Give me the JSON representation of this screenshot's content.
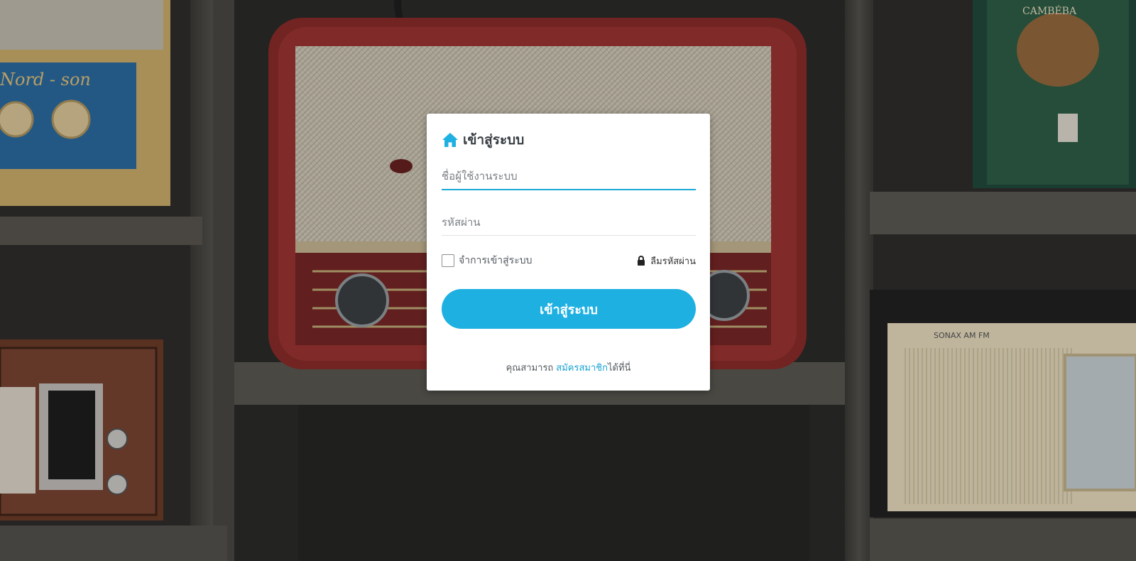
{
  "login": {
    "title": "เข้าสู่ระบบ",
    "username_placeholder": "ชื่อผู้ใช้งานระบบ",
    "password_placeholder": "รหัสผ่าน",
    "remember_label": "จำการเข้าสู่ระบบ",
    "forgot_label": "ลืมรหัสผ่าน",
    "submit_label": "เข้าสู่ระบบ",
    "signup_prefix": "คุณสามารถ",
    "signup_link": "สมัครสมาชิก",
    "signup_suffix": "ได้ที่นี่"
  },
  "icons": {
    "title_icon": "home-icon",
    "forgot_icon": "lock-icon"
  },
  "colors": {
    "accent": "#1fb0e2",
    "link": "#1aa3d4",
    "card": "#ffffff"
  }
}
